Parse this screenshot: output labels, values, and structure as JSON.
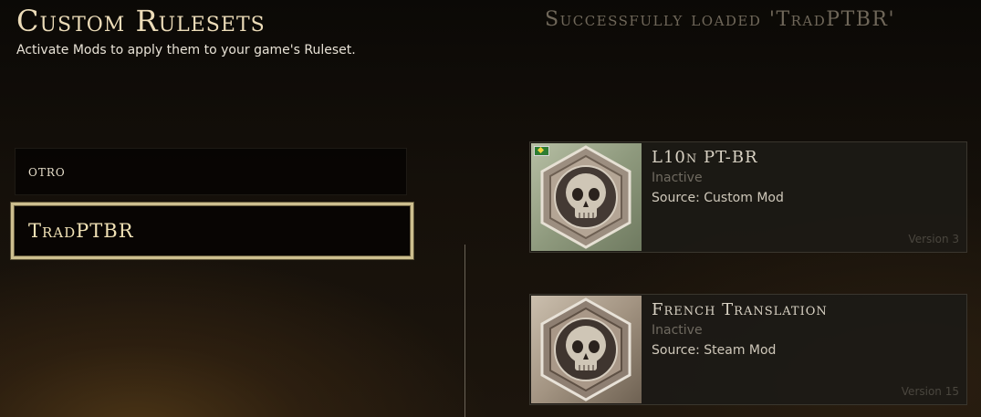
{
  "header": {
    "title": "Custom Rulesets",
    "subtitle": "Activate Mods to apply them to your game's Ruleset.",
    "status": "Successfully loaded 'TradPTBR'"
  },
  "rulesets": [
    {
      "label": "otro",
      "selected": false
    },
    {
      "label": "TradPTBR",
      "selected": true
    }
  ],
  "mods": [
    {
      "name": "L10n PT-BR",
      "status": "Inactive",
      "source": "Source: Custom Mod",
      "version": "Version 3",
      "thumbnail_icon": "skull-hexagon-icon",
      "flag_icon": "brazil-flag-icon"
    },
    {
      "name": "French Translation",
      "status": "Inactive",
      "source": "Source: Steam Mod",
      "version": "Version 15",
      "thumbnail_icon": "skull-hexagon-icon"
    }
  ],
  "colors": {
    "accent_gold": "#cdbf8f",
    "title_text": "#ecdcb8",
    "muted_text": "#6f6a60"
  }
}
